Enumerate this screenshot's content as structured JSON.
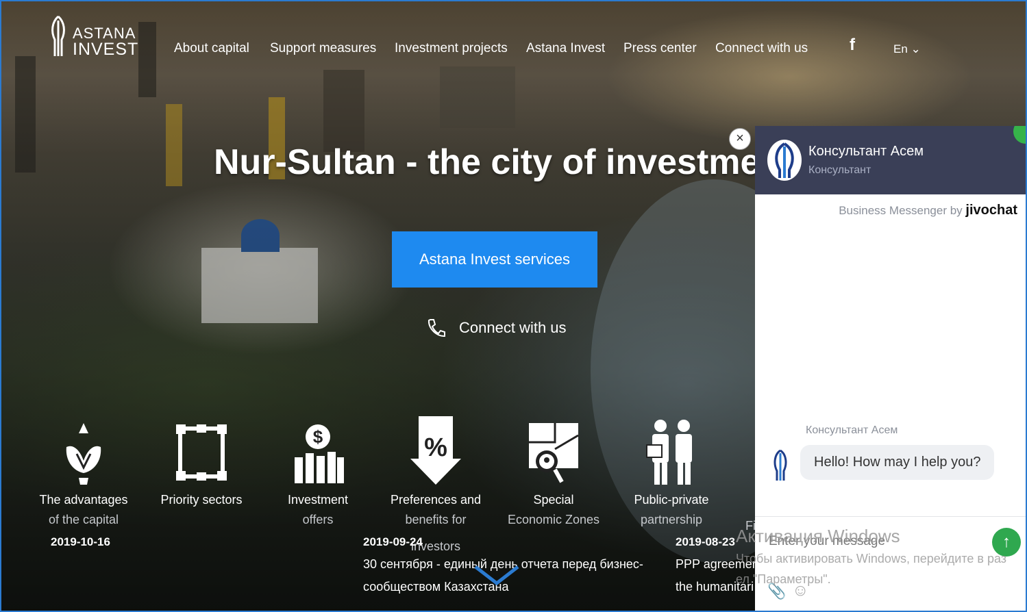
{
  "logo": {
    "line1": "ASTANA",
    "line2": "INVEST"
  },
  "nav": {
    "items": [
      {
        "label": "About capital"
      },
      {
        "label": "Support measures"
      },
      {
        "label": "Investment projects"
      },
      {
        "label": "Astana Invest"
      },
      {
        "label": "Press center"
      },
      {
        "label": "Connect with us"
      }
    ],
    "facebook": "f",
    "language": "En"
  },
  "hero": {
    "title": "Nur-Sultan - the city of investment",
    "cta": "Astana Invest services",
    "connect": "Connect with us"
  },
  "features": [
    {
      "icon": "lotus-icon",
      "line1": "The advantages",
      "line2": "of the capital"
    },
    {
      "icon": "frame-icon",
      "line1": "Priority sectors",
      "line2": ""
    },
    {
      "icon": "dollar-chart-icon",
      "line1": "Investment",
      "line2": "offers"
    },
    {
      "icon": "percent-arrow-icon",
      "line1": "Preferences and",
      "line2": "benefits for"
    },
    {
      "icon": "map-pin-icon",
      "line1": "Special",
      "line2": "Economic Zones"
    },
    {
      "icon": "people-icon",
      "line1": "Public-private",
      "line2": "partnership"
    }
  ],
  "feature_extra": {
    "line3": "investors",
    "partial": "Fi"
  },
  "news": [
    {
      "date": "2019-10-16",
      "lines": []
    },
    {
      "date": "2019-09-24",
      "lines": [
        "30 сентября - единый день отчета перед бизнес-",
        "сообществом Казахстана"
      ]
    },
    {
      "date": "2019-08-23",
      "lines": [
        "PPP agreement",
        "the humanitari"
      ]
    }
  ],
  "chat": {
    "agent_name": "Консультант Асем",
    "agent_role": "Консультант",
    "brand_prefix": "Business Messenger by",
    "brand_name": "jivochat",
    "message_sender": "Консультант Асем",
    "message": "Hello! How may I help you?",
    "input_placeholder": "Enter your message",
    "close": "×"
  },
  "os_watermark": {
    "title": "Активация Windows",
    "line1": "Чтобы активировать Windows, перейдите в раз",
    "line2": "ел \"Параметры\"."
  }
}
